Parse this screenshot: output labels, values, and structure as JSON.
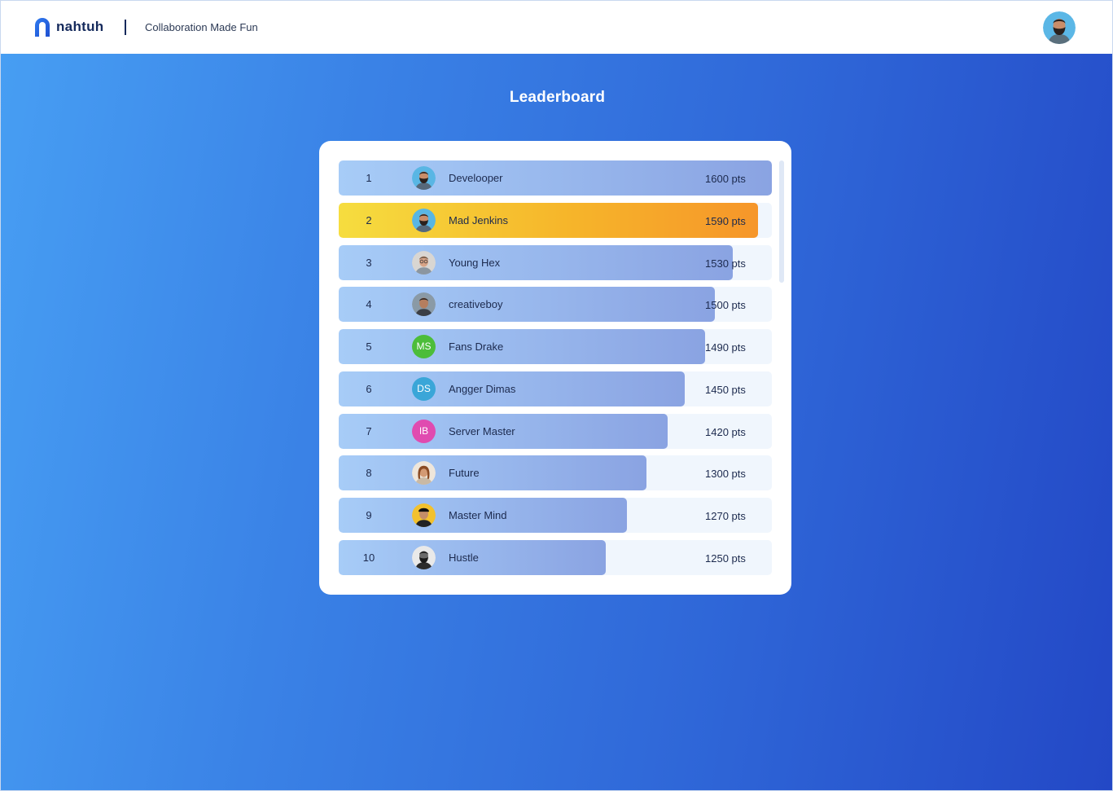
{
  "header": {
    "brand": "nahtuh",
    "tagline": "Collaboration Made Fun"
  },
  "page": {
    "title": "Leaderboard"
  },
  "colors": {
    "brand_dark": "#152a5c",
    "background_start": "#479ef3",
    "background_end": "#2348c6",
    "bar_default": "#97b6ec",
    "bar_highlight": "#f6b52a"
  },
  "leaderboard": {
    "rows": [
      {
        "rank": "1",
        "name": "Develooper",
        "points": "1600 pts",
        "score": 1600,
        "avatar": "person-beard-icon",
        "highlight": false
      },
      {
        "rank": "2",
        "name": "Mad Jenkins",
        "points": "1590 pts",
        "score": 1590,
        "avatar": "person-beard-icon",
        "highlight": true
      },
      {
        "rank": "3",
        "name": "Young Hex",
        "points": "1530 pts",
        "score": 1530,
        "avatar": "person-glasses-icon",
        "highlight": false
      },
      {
        "rank": "4",
        "name": "creativeboy",
        "points": "1500 pts",
        "score": 1500,
        "avatar": "person-icon",
        "highlight": false
      },
      {
        "rank": "5",
        "name": "Fans Drake",
        "points": "1490 pts",
        "score": 1490,
        "initials": "MS",
        "avatar_color": "#4cbd3a",
        "highlight": false
      },
      {
        "rank": "6",
        "name": "Angger Dimas",
        "points": "1450 pts",
        "score": 1450,
        "initials": "DS",
        "avatar_color": "#3aa6d8",
        "highlight": false
      },
      {
        "rank": "7",
        "name": "Server Master",
        "points": "1420 pts",
        "score": 1420,
        "initials": "IB",
        "avatar_color": "#e04bb0",
        "highlight": false
      },
      {
        "rank": "8",
        "name": "Future",
        "points": "1300 pts",
        "score": 1300,
        "avatar": "person-long-hair-icon",
        "highlight": false
      },
      {
        "rank": "9",
        "name": "Master Mind",
        "points": "1270 pts",
        "score": 1270,
        "avatar": "person-cap-icon",
        "highlight": false
      },
      {
        "rank": "10",
        "name": "Hustle",
        "points": "1250 pts",
        "score": 1250,
        "avatar": "person-bald-icon",
        "highlight": false
      }
    ]
  }
}
